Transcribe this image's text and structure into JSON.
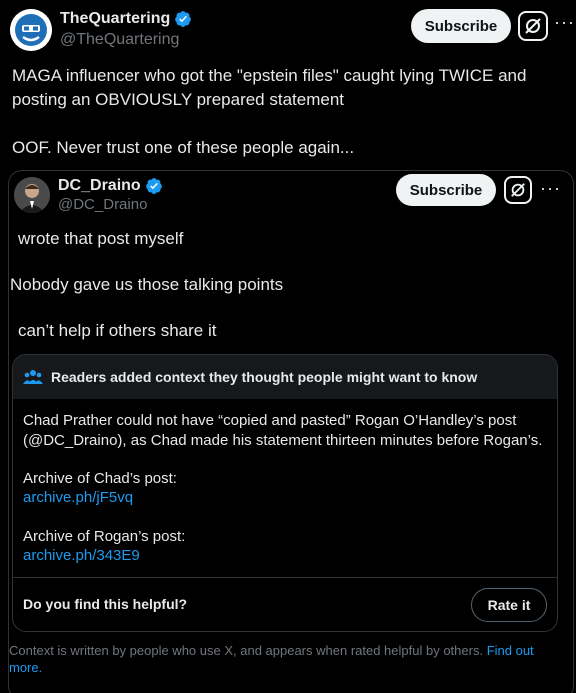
{
  "outer_post": {
    "author_name": "TheQuartering",
    "author_handle": "@TheQuartering",
    "subscribe_label": "Subscribe",
    "text_line1": "MAGA influencer who got the \"epstein files\" caught lying TWICE and",
    "text_line2": "posting an OBVIOUSLY prepared statement",
    "text_line3": "OOF.  Never trust one of these people again..."
  },
  "quoted_post": {
    "author_name": "DC_Draino",
    "author_handle": "@DC_Draino",
    "subscribe_label": "Subscribe",
    "line1": "wrote that post myself",
    "line2": "Nobody gave us those talking points",
    "line3": "can’t help if others share it"
  },
  "community_note": {
    "header": "Readers added context they thought people might want to know",
    "body_line1": "Chad Prather could not have “copied and pasted” Rogan O’Handley’s post",
    "body_line2": "(@DC_Draino), as Chad made his statement thirteen minutes before Rogan’s.",
    "archive1_label": "Archive of Chad’s post:",
    "archive1_link": "archive.ph/jF5vq",
    "archive2_label": "Archive of Rogan’s post:",
    "archive2_link": "archive.ph/343E9",
    "helpful_prompt": "Do you find this helpful?",
    "rate_label": "Rate it",
    "disclaimer": "Context is written by people who use X, and appears when rated helpful by others.",
    "find_out_more": "Find out more."
  },
  "colors": {
    "background": "#000000",
    "accent": "#1d9bf0",
    "verified": "#1d9bf0"
  },
  "icons": [
    "verified-badge-icon",
    "grok-icon",
    "more-icon",
    "readers-icon"
  ]
}
